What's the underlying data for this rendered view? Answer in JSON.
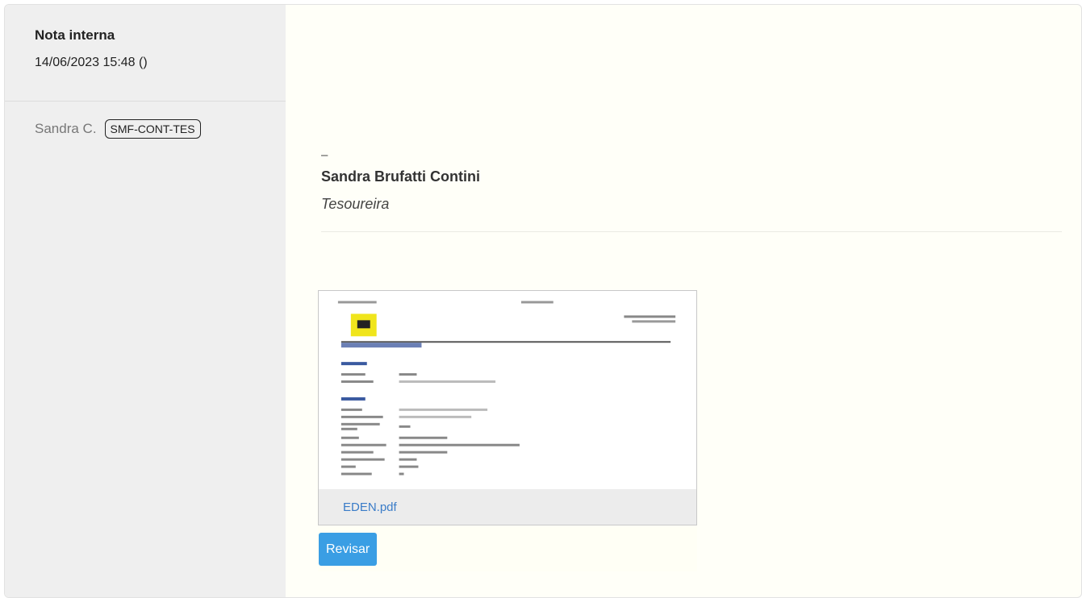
{
  "note": {
    "title": "Nota interna",
    "datetime": "14/06/2023 15:48 ()",
    "author_name": "Sandra C.",
    "author_tag": "SMF-CONT-TES"
  },
  "signature": {
    "dash": "–",
    "name": "Sandra Brufatti Contini",
    "role": "Tesoureira"
  },
  "attachment": {
    "filename": "EDEN.pdf"
  },
  "actions": {
    "review_label": "Revisar"
  },
  "colors": {
    "sidebar_bg": "#efefef",
    "content_bg": "#fffff8",
    "link": "#3a7cc8",
    "button": "#3a9ee4"
  }
}
